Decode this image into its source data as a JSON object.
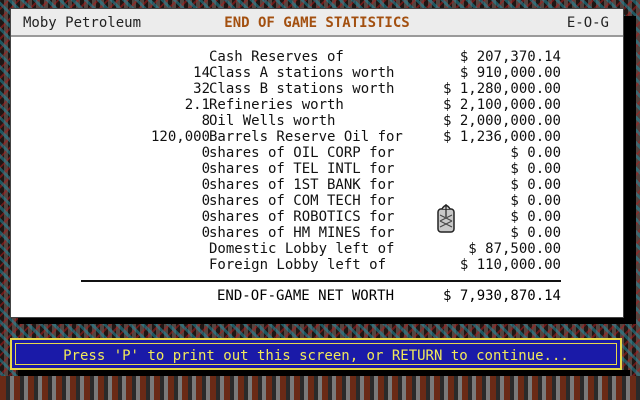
{
  "titlebar": {
    "left": "Moby Petroleum",
    "center": "END OF GAME STATISTICS",
    "right": "E-O-G"
  },
  "rows": [
    {
      "num": "",
      "desc": "Cash Reserves of",
      "val": "$ 207,370.14"
    },
    {
      "num": "14",
      "desc": "Class A stations worth",
      "val": "$ 910,000.00"
    },
    {
      "num": "32",
      "desc": "Class B stations worth",
      "val": "$ 1,280,000.00"
    },
    {
      "num": "2.1",
      "desc": "Refineries worth",
      "val": "$ 2,100,000.00"
    },
    {
      "num": "8",
      "desc": "Oil Wells worth",
      "val": "$ 2,000,000.00"
    },
    {
      "num": "120,000",
      "desc": "Barrels Reserve Oil for",
      "val": "$ 1,236,000.00"
    },
    {
      "num": "0",
      "desc": "shares of OIL CORP for",
      "val": "$ 0.00"
    },
    {
      "num": "0",
      "desc": "shares of TEL INTL for",
      "val": "$ 0.00"
    },
    {
      "num": "0",
      "desc": "shares of 1ST BANK for",
      "val": "$ 0.00"
    },
    {
      "num": "0",
      "desc": "shares of COM TECH for",
      "val": "$ 0.00"
    },
    {
      "num": "0",
      "desc": "shares of ROBOTICS for",
      "val": "$ 0.00"
    },
    {
      "num": "0",
      "desc": "shares of HM MINES for",
      "val": "$ 0.00"
    },
    {
      "num": "",
      "desc": "Domestic Lobby left of",
      "val": "$ 87,500.00"
    },
    {
      "num": "",
      "desc": "Foreign Lobby left of",
      "val": "$ 110,000.00"
    }
  ],
  "net_worth": {
    "label": "END-OF-GAME NET WORTH",
    "value": "$ 7,930,870.14"
  },
  "prompt": "Press 'P' to print out this screen, or RETURN to continue...",
  "cursor_icon": "mouse-cursor-icon",
  "colors": {
    "title_accent": "#a35010",
    "prompt_bg": "#1a1aa8",
    "prompt_text": "#f2ea5a"
  }
}
